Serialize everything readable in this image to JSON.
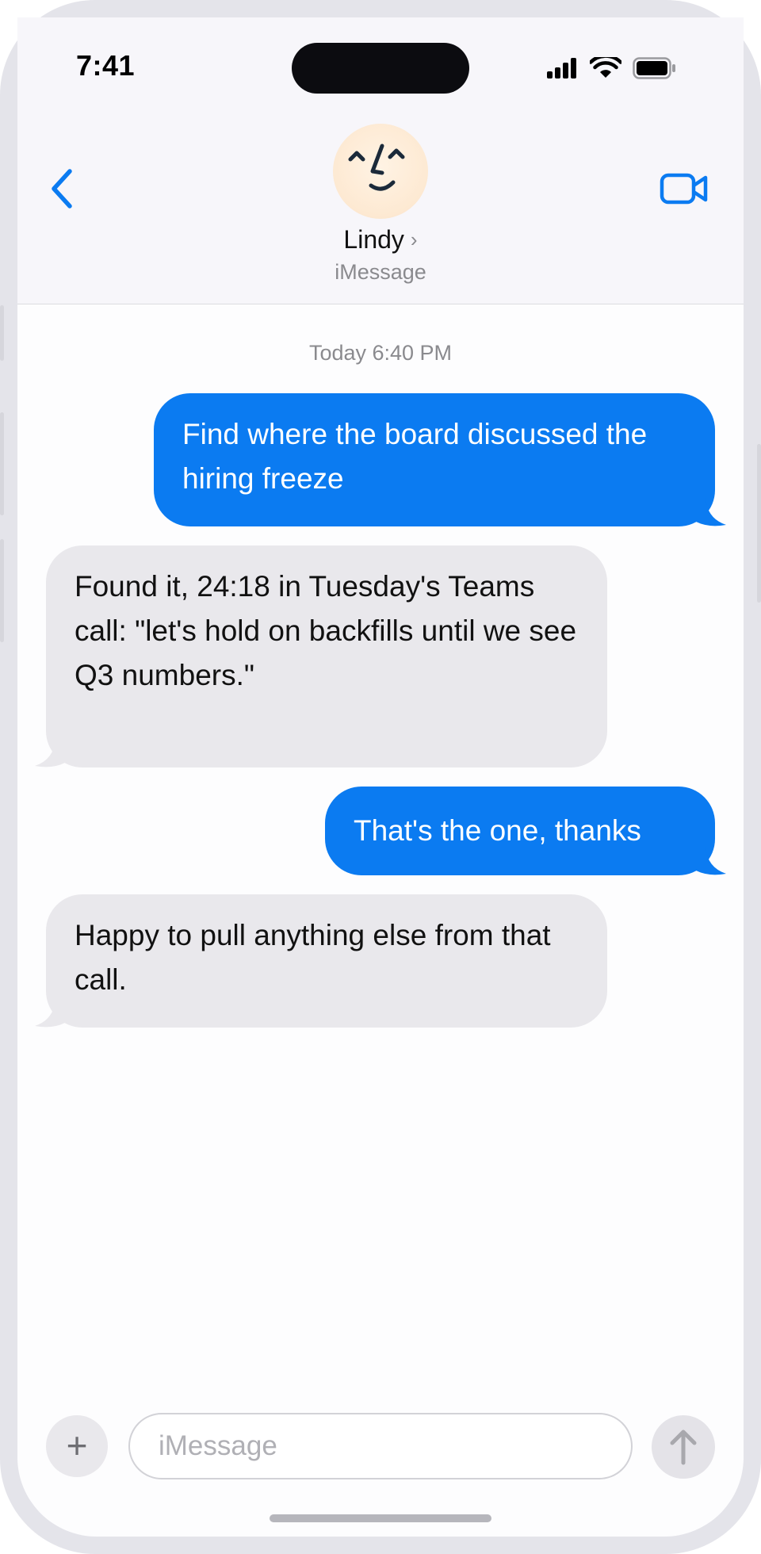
{
  "status_bar": {
    "time": "7:41"
  },
  "header": {
    "contact_name": "Lindy",
    "name_chevron": "›",
    "subtitle": "iMessage",
    "icons": [
      "back-chevron-icon",
      "video-camera-icon",
      "avatar-face-icon"
    ]
  },
  "conversation": {
    "timestamp": "Today 6:40 PM",
    "messages": [
      {
        "from": "me",
        "text": "Find where the board discussed the hiring freeze"
      },
      {
        "from": "Lindy",
        "text": "Found it, 24:18 in Tuesday's Teams call: \"let's hold on backfills until we see Q3 numbers.\""
      },
      {
        "from": "me",
        "text": "That's the one, thanks"
      },
      {
        "from": "Lindy",
        "text": "Happy to pull anything else from that call."
      }
    ]
  },
  "composer": {
    "plus_label": "+",
    "placeholder": "iMessage",
    "value": ""
  },
  "colors": {
    "sent_bubble": "#0b7bf1",
    "received_bubble": "#e9e8ec",
    "accent": "#0b7bf1"
  }
}
